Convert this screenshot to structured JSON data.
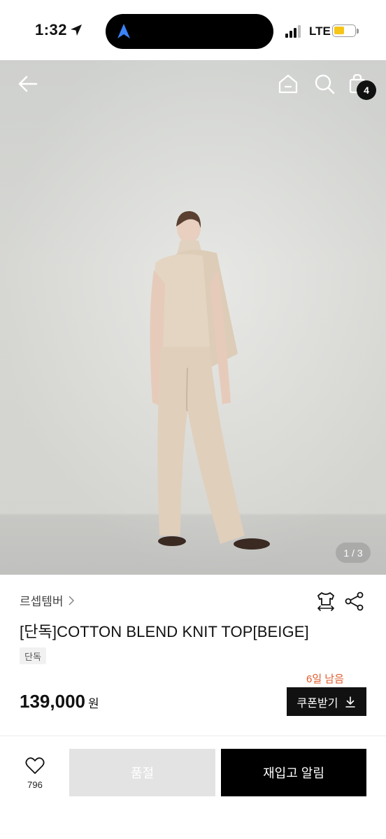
{
  "status_bar": {
    "time": "1:32",
    "network": "LTE",
    "icons": [
      "location-arrow-icon",
      "signal-icon",
      "battery-icon"
    ]
  },
  "header": {
    "icons": [
      "back-arrow-icon",
      "home-icon",
      "search-icon",
      "shopping-bag-icon"
    ],
    "cart_count": "4"
  },
  "gallery": {
    "page_indicator": "1 / 3",
    "current": 1,
    "total": 3
  },
  "product": {
    "brand": "르셉템버",
    "title": "[단독]COTTON BLEND KNIT TOP[BEIGE]",
    "tag": "단독",
    "days_left": "6일 남음",
    "price": "139,000",
    "price_unit": "원",
    "coupon_label": "쿠폰받기"
  },
  "bottom_bar": {
    "like_count": "796",
    "soldout_label": "품절",
    "restock_label": "재입고 알림"
  },
  "colors": {
    "accent_orange": "#e05a2a",
    "primary_black": "#000000",
    "disabled_gray": "#e3e3e3",
    "battery_yellow": "#f5c518"
  }
}
